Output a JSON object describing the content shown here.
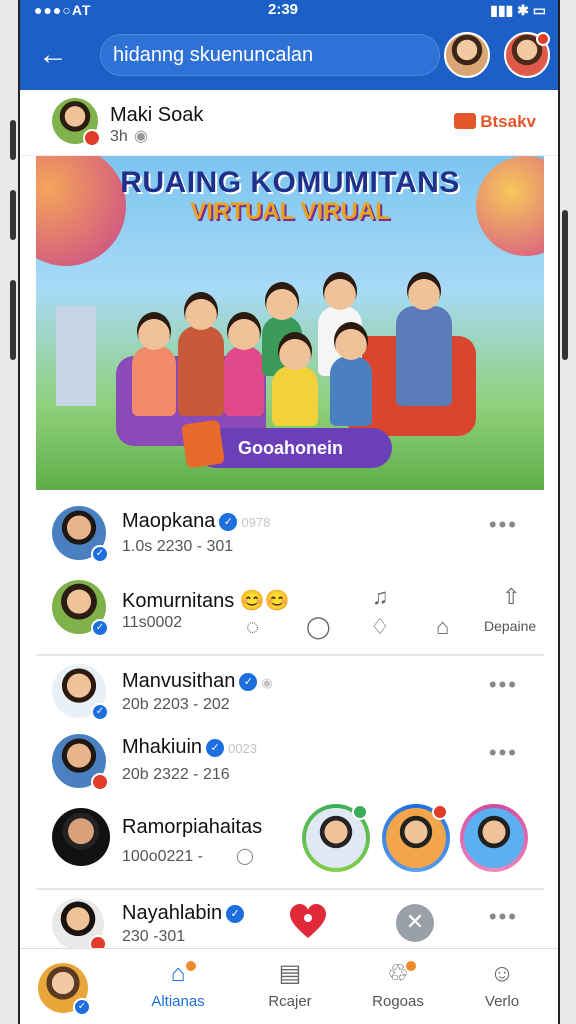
{
  "status": {
    "signal": "●●●○AT",
    "time": "2:39",
    "battery_icon": "battery-icon"
  },
  "header": {
    "search_text": "hidanng skuenuncalan",
    "back_icon": "arrow-left-icon"
  },
  "post": {
    "author": "Maki Soak",
    "meta": "3h",
    "tag_label": "Btsakv",
    "banner_title": "RUAING KOMUMITANS",
    "banner_subtitle": "VIRTUAL VIRUAL",
    "join_label": "Gooahonein"
  },
  "rows": [
    {
      "name": "Maopkana",
      "extra": "0978",
      "sub": "1.0s 2230 - 301"
    },
    {
      "name": "Komurnitans",
      "extra": "😊😊",
      "sub": "11s0002"
    },
    {
      "name": "Manvusithan",
      "extra": "",
      "sub": "20b 2203 - 202"
    },
    {
      "name": "Mhakiuin",
      "extra": "0023",
      "sub": "20b 2322 - 216"
    },
    {
      "name": "Ramorpiahaitas",
      "extra": "",
      "sub": "100o0221 -"
    },
    {
      "name": "Nayahlabin",
      "extra": "",
      "sub": "230 -301"
    }
  ],
  "actions": {
    "share_label": "Depaine"
  },
  "tabs": [
    {
      "label": "Altianas",
      "icon": "home-icon"
    },
    {
      "label": "Rcajer",
      "icon": "news-icon"
    },
    {
      "label": "Rogoas",
      "icon": "bell-icon"
    },
    {
      "label": "Verlo",
      "icon": "profile-icon"
    }
  ],
  "colors": {
    "brand": "#1c5fc6",
    "accent": "#e3572b",
    "verify": "#1d6fe0"
  }
}
